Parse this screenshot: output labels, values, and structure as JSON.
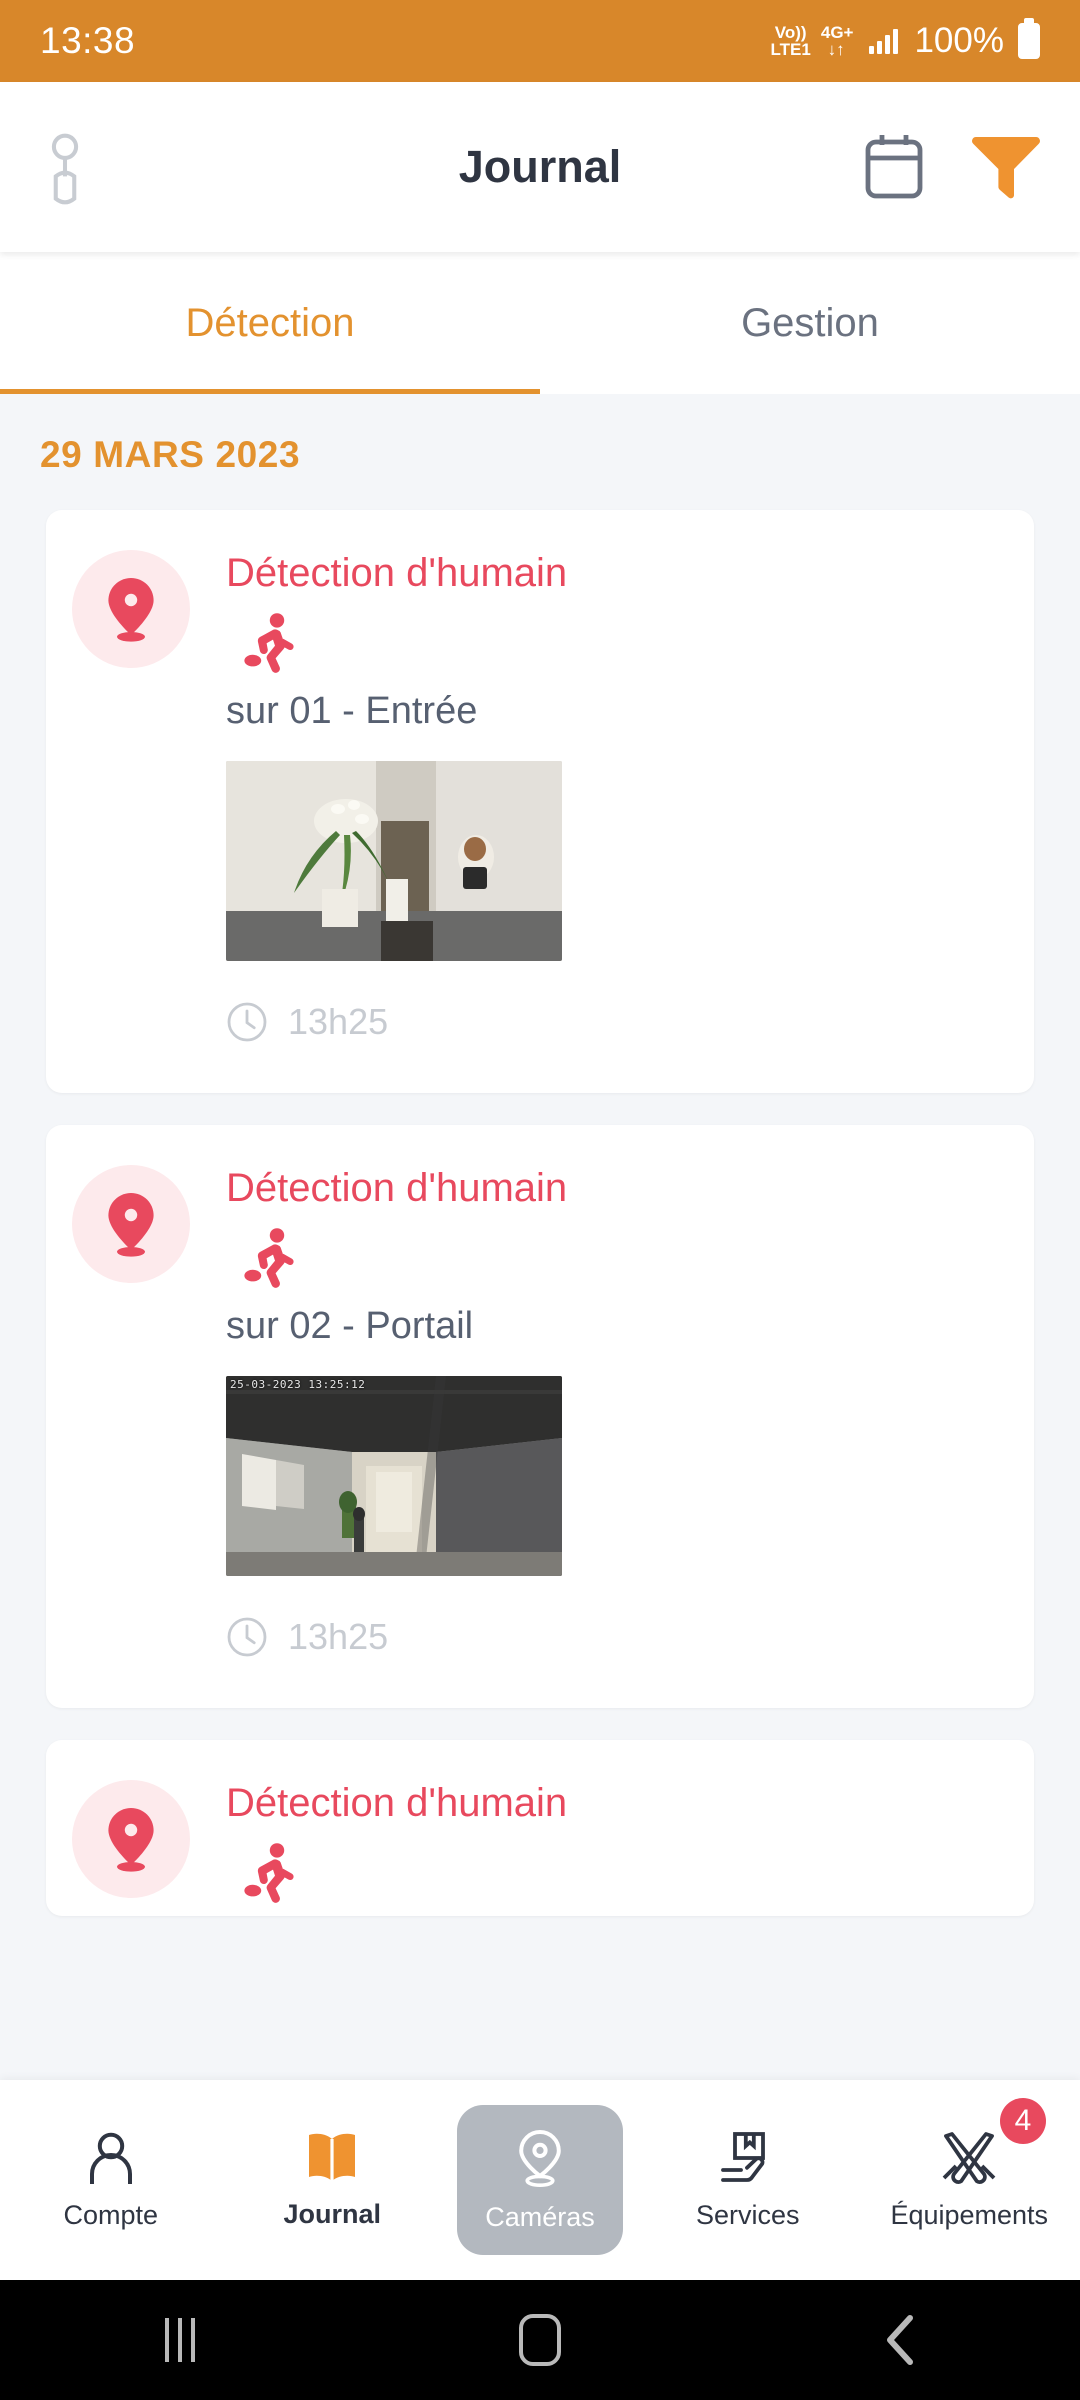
{
  "statusbar": {
    "time": "13:38",
    "volte_top": "Vo))",
    "volte_bottom": "LTE1",
    "network_top": "4G+",
    "data_arrows": "↓↑",
    "battery_percent": "100%"
  },
  "header": {
    "title": "Journal",
    "profile_icon": "person-icon",
    "calendar_icon": "calendar-icon",
    "filter_icon": "filter-funnel-icon",
    "accent_color": "#e3922f"
  },
  "tabs": [
    {
      "label": "Détection",
      "active": true
    },
    {
      "label": "Gestion",
      "active": false
    }
  ],
  "journal": {
    "date_header": "29 MARS 2023",
    "accent_color": "#e3922f",
    "alert_color": "#e8495e",
    "entries": [
      {
        "title": "Détection d'humain",
        "type_icon": "running-person-icon",
        "pin_icon": "location-pin-icon",
        "camera": "sur 01 - Entrée",
        "time": "13h25",
        "clock_icon": "clock-icon",
        "thumbnail_stamp": ""
      },
      {
        "title": "Détection d'humain",
        "type_icon": "running-person-icon",
        "pin_icon": "location-pin-icon",
        "camera": "sur 02 - Portail",
        "time": "13h25",
        "clock_icon": "clock-icon",
        "thumbnail_stamp": "25-03-2023 13:25:12"
      },
      {
        "title": "Détection d'humain",
        "type_icon": "running-person-icon",
        "pin_icon": "location-pin-icon",
        "camera": "",
        "time": "",
        "clock_icon": "clock-icon",
        "thumbnail_stamp": ""
      }
    ]
  },
  "bottomnav": [
    {
      "label": "Compte",
      "icon": "account-person-icon",
      "state": "default"
    },
    {
      "label": "Journal",
      "icon": "open-book-icon",
      "state": "active"
    },
    {
      "label": "Caméras",
      "icon": "camera-dome-icon",
      "state": "selected"
    },
    {
      "label": "Services",
      "icon": "services-box-hand-icon",
      "state": "default"
    },
    {
      "label": "Équipements",
      "icon": "tools-icon",
      "state": "default",
      "badge": "4"
    }
  ],
  "androidnav": {
    "recents_icon": "recent-apps-icon",
    "home_icon": "home-icon",
    "back_icon": "back-chevron-icon"
  }
}
